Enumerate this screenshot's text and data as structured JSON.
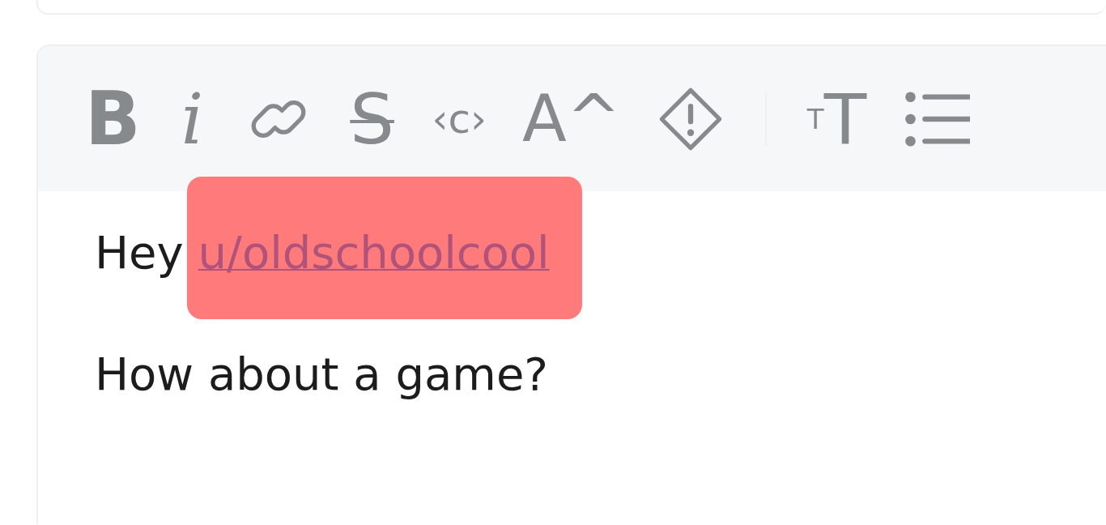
{
  "toolbar": [
    {
      "kind": "bold",
      "glyph": "B"
    },
    {
      "kind": "italic",
      "glyph": "i"
    },
    {
      "kind": "link"
    },
    {
      "kind": "strike",
      "glyph": "S"
    },
    {
      "kind": "code",
      "glyph": "‹c›"
    },
    {
      "kind": "superscript",
      "glyph": "A^"
    },
    {
      "kind": "spoiler"
    },
    {
      "kind": "divider"
    },
    {
      "kind": "heading",
      "glyph": "$^{T}$T"
    },
    {
      "kind": "list"
    }
  ],
  "body": [
    {
      "parts": [
        {
          "kind": "text",
          "text": "Hey "
        },
        {
          "kind": "mention",
          "text": "u/oldschoolcool",
          "highlighted": true
        }
      ]
    },
    {
      "parts": [
        {
          "kind": "text",
          "text": "How about a game?"
        }
      ]
    }
  ]
}
